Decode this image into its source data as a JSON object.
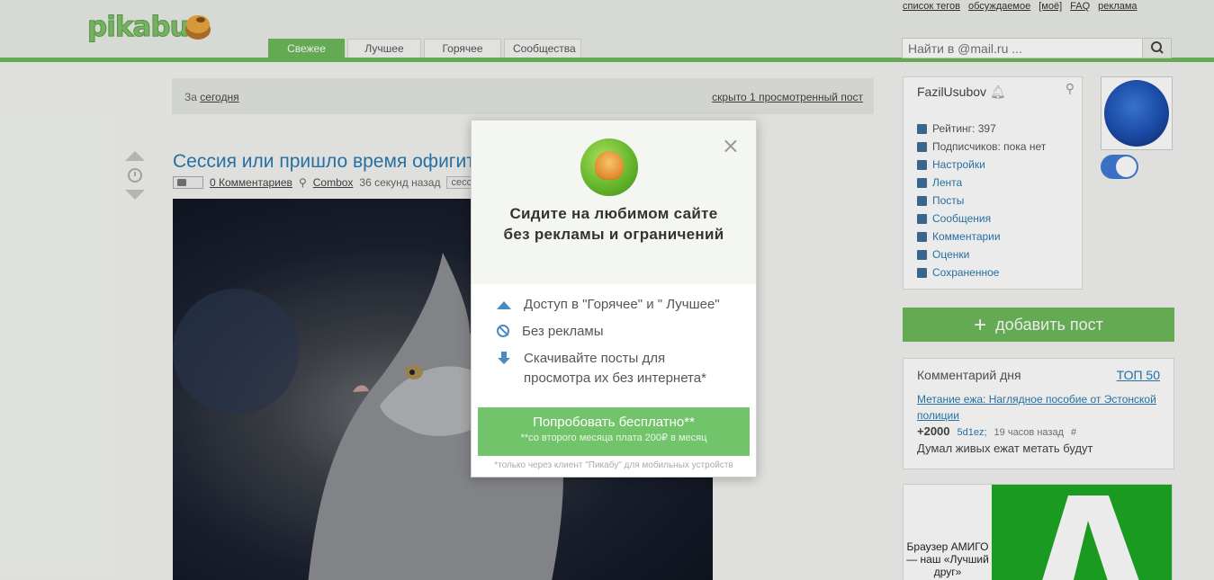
{
  "header": {
    "logo_text": "pikabu",
    "top_links": [
      "список тегов",
      "обсуждаемое",
      "[моё]",
      "FAQ",
      "реклама"
    ],
    "tabs": [
      "Свежее",
      "Лучшее",
      "Горячее",
      "Сообщества"
    ],
    "active_tab": "Свежее",
    "search_placeholder": "Найти в @mail.ru ..."
  },
  "filter": {
    "prefix": "За",
    "period": "сегодня",
    "hidden_posts": "скрыто 1 просмотренный пост"
  },
  "post": {
    "title": "Сессия или пришло время офигител",
    "comments": "0 Комментариев",
    "author": "Combox",
    "time": "36 секунд назад",
    "tag": "сесс",
    "photo_badge": "–"
  },
  "sidebar": {
    "username": "FazilUsubov",
    "rating": "Рейтинг: 397",
    "subscribers": "Подписчиков: пока нет",
    "menu": [
      "Настройки",
      "Лента",
      "Посты",
      "Сообщения",
      "Комментарии",
      "Оценки",
      "Сохраненное"
    ],
    "add_post": "добавить пост",
    "comment_of_day": {
      "title": "Комментарий дня",
      "top_link": "ТОП 50",
      "post_link": "Метание ежа: Наглядное пособие от Эстонской полиции",
      "score": "+2000",
      "nick": "5d1ez;",
      "time": "19 часов назад",
      "hash": "#",
      "text": "Думал живых ежат метать будут"
    },
    "ad_text": "Браузер АМИГО — наш «Лучший друг»"
  },
  "modal": {
    "close": "×",
    "title_line1": "Сидите на любимом сайте",
    "title_line2": "без рекламы и ограничений",
    "features": [
      "Доступ в \"Горячее\" и \" Лучшее\"",
      "Без рекламы",
      "Скачивайте посты для просмотра их без интернета*"
    ],
    "button_main": "Попробовать бесплатно**",
    "button_sub": "**со второго месяца плата 200₽ в месяц",
    "footnote": "*только через клиент \"Пикабу\" для мобильных устройств"
  },
  "colors": {
    "brand_green": "#6cb95b",
    "link_blue": "#2a7ab0",
    "icon_blue": "#4a8ac4"
  }
}
